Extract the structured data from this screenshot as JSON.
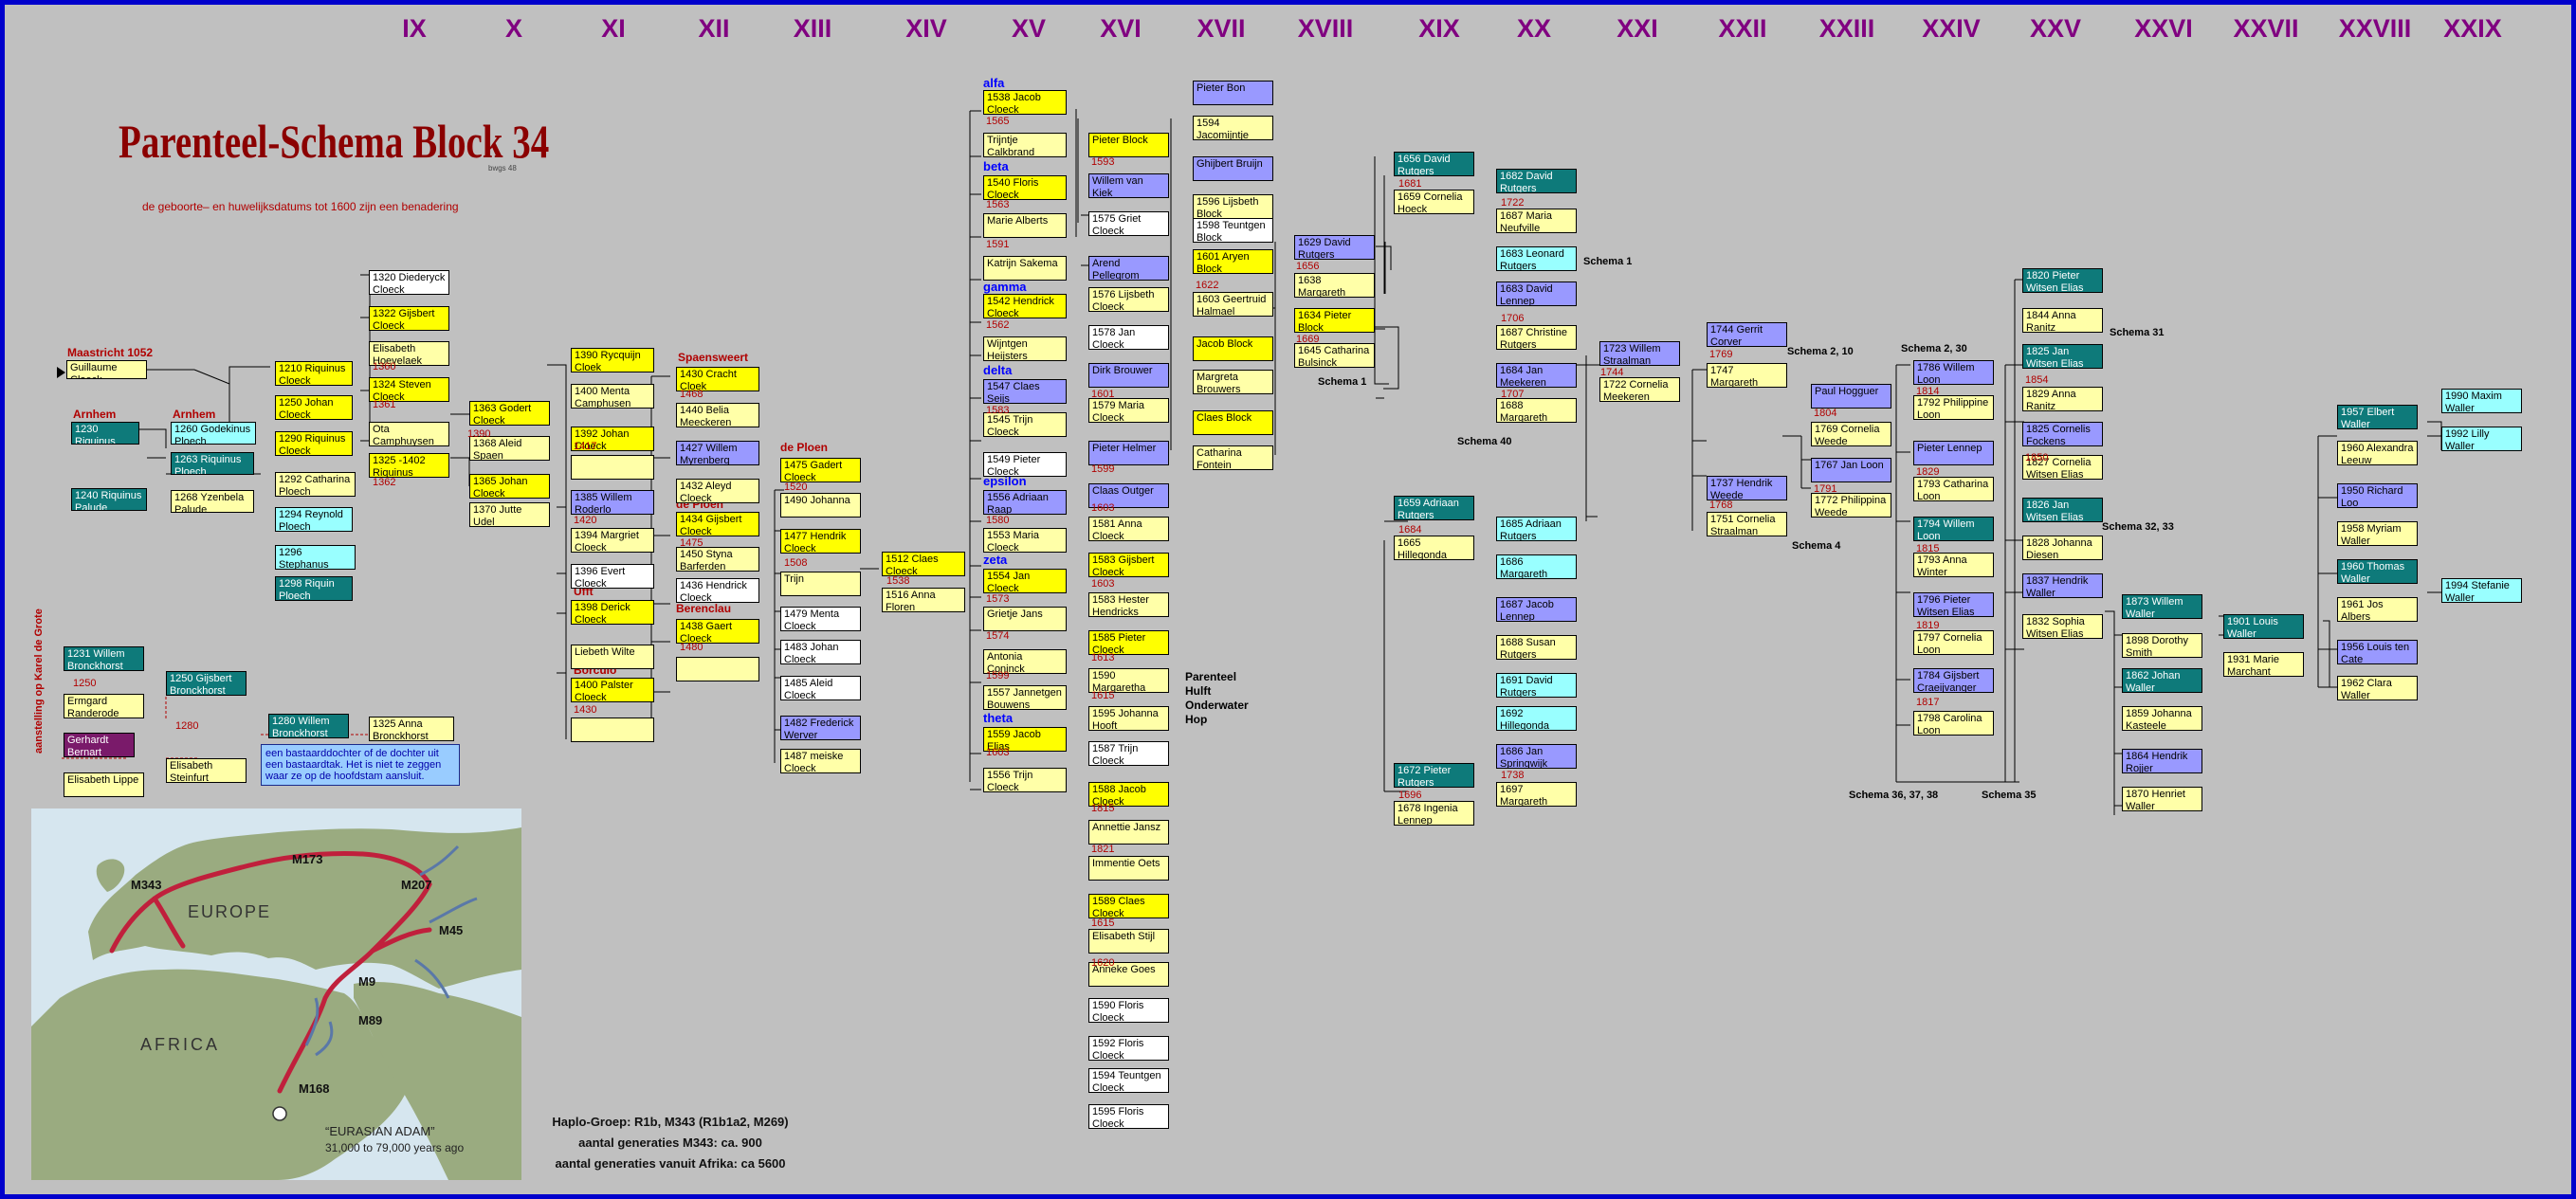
{
  "title": "Parenteel-Schema Block 34",
  "title_small": "bwgs 48",
  "subtitle": "de geboorte– en huwelijksdatums tot 1600 zijn een benadering",
  "centuries": [
    "IX",
    "X",
    "XI",
    "XII",
    "XIII",
    "XIV",
    "XV",
    "XVI",
    "XVII",
    "XVIII",
    "XIX",
    "XX",
    "XXI",
    "XXII",
    "XXIII",
    "XXIV",
    "XXV",
    "XXVI",
    "XXVII",
    "XXVIII",
    "XXIX"
  ],
  "places": {
    "maastricht": "Maastricht 1052",
    "arnhem1": "Arnhem",
    "arnhem2": "Arnhem",
    "spaensweert": "Spaensweert",
    "deploen1": "de Ploen",
    "deploen2": "de Ploen",
    "deploen3": "de Ploen",
    "berenclau": "Berenclau",
    "ufft": "Ufft",
    "borculo": "Borculo"
  },
  "vertical_note": "aanstelling op Karel de Grote",
  "bastard_note": "een bastaarddochter of de dochter uit een bastaardtak. Het is niet te zeggen waar ze op de hoofdstam aansluit.",
  "greek": {
    "alfa": "alfa",
    "beta": "beta",
    "gamma": "gamma",
    "delta": "delta",
    "epsilon": "epsilon",
    "zeta": "zeta",
    "theta": "theta"
  },
  "parent_note": [
    "Parenteel",
    "Hulft",
    "Onderwater",
    "Hop"
  ],
  "schemas": {
    "s1a": "Schema 1",
    "s1b": "Schema 1",
    "s40": "Schema 40",
    "s210": "Schema 2, 10",
    "s230": "Schema 2, 30",
    "s31": "Schema 31",
    "s4": "Schema 4",
    "s3233": "Schema 32, 33",
    "s363738": "Schema 36, 37, 38",
    "s35": "Schema 35"
  },
  "haplo": [
    "Haplo-Groep: R1b, M343 (R1b1a2, M269)",
    "aantal generaties M343: ca. 900",
    "aantal generaties vanuit Afrika: ca 5600"
  ],
  "map": {
    "europe": "EUROPE",
    "africa": "AFRICA",
    "adam": "“EURASIAN ADAM”",
    "adam_years": "31,000 to 79,000 years ago",
    "markers": [
      "M343",
      "M173",
      "M207",
      "M45",
      "M9",
      "M89",
      "M168"
    ]
  },
  "colors": {
    "frame": "#0000cc",
    "background": "#c0c0c0",
    "century": "#800080",
    "marriage": "#b00000",
    "yellow": "#ffff00",
    "light_yellow": "#ffffa8",
    "blue": "#9999ff",
    "teal": "#0e7a7a",
    "cyan": "#99ffff"
  },
  "persons": [
    {
      "t": "Guillaume Cloeck",
      "c": "ly"
    },
    {
      "t": "1230 Riquinus Ploech",
      "c": "t"
    },
    {
      "t": "1240 Riquinus Palude",
      "c": "t"
    },
    {
      "t": "1260 Godekinus Ploech",
      "c": "c"
    },
    {
      "t": "1263 Riquinus Ploech",
      "c": "t"
    },
    {
      "t": "1268 Yzenbela Palude",
      "c": "ly"
    },
    {
      "t": "1210 Riquinus Cloeck",
      "c": "y"
    },
    {
      "t": "1250 Johan Cloeck",
      "c": "y"
    },
    {
      "t": "1290 Riquinus Cloeck",
      "c": "y"
    },
    {
      "t": "1292 Catharina Ploech",
      "c": "ly"
    },
    {
      "t": "1294 Reynold Ploech",
      "c": "c"
    },
    {
      "t": "1296 Stephanus Ploech",
      "c": "c"
    },
    {
      "t": "1298 Riquin Ploech",
      "c": "t"
    },
    {
      "t": "1320 Diederyck Cloeck",
      "c": "w"
    },
    {
      "t": "1322 Gijsbert Cloeck",
      "c": "y"
    },
    {
      "t": "Elisabeth Hoevelaek",
      "c": "ly"
    },
    {
      "t": "1324 Steven Cloeck",
      "c": "y"
    },
    {
      "t": "Ota Camphuysen",
      "c": "ly"
    },
    {
      "t": "1325 -1402 Riquinus Cloeck",
      "c": "y"
    },
    {
      "t": "1363 Godert Cloeck",
      "c": "y"
    },
    {
      "t": "1368 Aleid Spaen",
      "c": "ly"
    },
    {
      "t": "1365 Johan Cloeck",
      "c": "y"
    },
    {
      "t": "1370 Jutte Udel",
      "c": "ly"
    },
    {
      "t": "1231 Willem Bronckhorst",
      "c": "t"
    },
    {
      "t": "Ermgard Randerode",
      "c": "ly"
    },
    {
      "t": "Gerhardt Bernart",
      "c": "pu"
    },
    {
      "t": "Elisabeth Lippe",
      "c": "ly"
    },
    {
      "t": "1250 Gijsbert Bronckhorst",
      "c": "t"
    },
    {
      "t": "Elisabeth Steinfurt",
      "c": "ly"
    },
    {
      "t": "1280 Willem Bronckhorst",
      "c": "t"
    },
    {
      "t": "1325 Anna Bronckhorst",
      "c": "ly"
    },
    {
      "t": "1390 Rycquijn Cloek",
      "c": "y"
    },
    {
      "t": "1400 Menta Camphusen",
      "c": "ly"
    },
    {
      "t": "1392 Johan Cloeck",
      "c": "y"
    },
    {
      "t": "",
      "c": "ly"
    },
    {
      "t": "1385 Willem Roderlo",
      "c": "bl"
    },
    {
      "t": "1394 Margriet Cloeck",
      "c": "ly"
    },
    {
      "t": "1396 Evert Cloeck",
      "c": "w"
    },
    {
      "t": "1398 Derick Cloeck",
      "c": "y"
    },
    {
      "t": "Liebeth Wilte",
      "c": "ly"
    },
    {
      "t": "1400 Palster Cloeck",
      "c": "y"
    },
    {
      "t": "",
      "c": "ly"
    },
    {
      "t": "1430 Cracht Cloek",
      "c": "y"
    },
    {
      "t": "1440 Belia Meeckeren",
      "c": "ly"
    },
    {
      "t": "1427 Willem Myrenberg",
      "c": "bl"
    },
    {
      "t": "1432 Aleyd Cloeck",
      "c": "ly"
    },
    {
      "t": "1434 Gijsbert Cloeck",
      "c": "y"
    },
    {
      "t": "1450 Styna Barferden",
      "c": "ly"
    },
    {
      "t": "1436 Hendrick Cloeck",
      "c": "w"
    },
    {
      "t": "1438 Gaert Cloeck",
      "c": "y"
    },
    {
      "t": "",
      "c": "ly"
    },
    {
      "t": "1475 Gadert Cloeck",
      "c": "y"
    },
    {
      "t": "1490 Johanna",
      "c": "ly"
    },
    {
      "t": "1477 Hendrik Cloeck",
      "c": "y"
    },
    {
      "t": "Trijn",
      "c": "ly"
    },
    {
      "t": "1479 Menta Cloeck",
      "c": "w"
    },
    {
      "t": "1483 Johan Cloeck",
      "c": "w"
    },
    {
      "t": "1485 Aleid Cloeck",
      "c": "w"
    },
    {
      "t": "1482 Frederick Werver",
      "c": "bl"
    },
    {
      "t": "1487 meiske Cloeck",
      "c": "ly"
    },
    {
      "t": "1512 Claes Cloeck",
      "c": "y"
    },
    {
      "t": "1516 Anna Floren",
      "c": "ly"
    },
    {
      "t": "1538 Jacob Cloeck",
      "c": "y"
    },
    {
      "t": "Trijntje Calkbrand",
      "c": "ly"
    },
    {
      "t": "1540 Floris Cloeck",
      "c": "y"
    },
    {
      "t": "Marie Alberts",
      "c": "ly"
    },
    {
      "t": "Katrijn Sakema",
      "c": "ly"
    },
    {
      "t": "1542 Hendrick Cloeck",
      "c": "y"
    },
    {
      "t": "Wijntgen Heijsters",
      "c": "ly"
    },
    {
      "t": "1547 Claes Seijs",
      "c": "bl"
    },
    {
      "t": "1545 Trijn Cloeck",
      "c": "ly"
    },
    {
      "t": "1549 Pieter Cloeck",
      "c": "w"
    },
    {
      "t": "1556 Adriaan Raap",
      "c": "bl"
    },
    {
      "t": "1553 Maria Cloeck",
      "c": "ly"
    },
    {
      "t": "1554 Jan Cloeck",
      "c": "y"
    },
    {
      "t": "Grietje Jans",
      "c": "ly"
    },
    {
      "t": "Antonia Coninck",
      "c": "ly"
    },
    {
      "t": "1557 Jannetgen Bouwens",
      "c": "ly"
    },
    {
      "t": "1559 Jacob Elias",
      "c": "y"
    },
    {
      "t": "1556 Trijn Cloeck",
      "c": "ly"
    },
    {
      "t": "Pieter Block",
      "c": "y"
    },
    {
      "t": "Willem van Kiek",
      "c": "bl"
    },
    {
      "t": "1575 Griet Cloeck",
      "c": "w"
    },
    {
      "t": "Arend Pellegrom",
      "c": "bl"
    },
    {
      "t": "1576 Lijsbeth Cloeck",
      "c": "ly"
    },
    {
      "t": "1578 Jan Cloeck",
      "c": "w"
    },
    {
      "t": "Dirk Brouwer",
      "c": "bl"
    },
    {
      "t": "1579 Maria Cloeck",
      "c": "ly"
    },
    {
      "t": "Pieter Helmer",
      "c": "bl"
    },
    {
      "t": "Claas Outger",
      "c": "bl"
    },
    {
      "t": "1581 Anna Cloeck",
      "c": "ly"
    },
    {
      "t": "1583 Gijsbert Cloeck",
      "c": "y"
    },
    {
      "t": "1583 Hester Hendricks",
      "c": "ly"
    },
    {
      "t": "1585 Pieter Cloeck",
      "c": "y"
    },
    {
      "t": "1590 Margaretha Noyer",
      "c": "ly"
    },
    {
      "t": "1595 Johanna Hooft",
      "c": "ly"
    },
    {
      "t": "1587 Trijn Cloeck",
      "c": "w"
    },
    {
      "t": "1588 Jacob Cloeck",
      "c": "y"
    },
    {
      "t": "Annettie Jansz",
      "c": "ly"
    },
    {
      "t": "Immentie Oets",
      "c": "ly"
    },
    {
      "t": "1589 Claes Cloeck",
      "c": "y"
    },
    {
      "t": "Elisabeth Stijl",
      "c": "ly"
    },
    {
      "t": "Anneke Goes",
      "c": "ly"
    },
    {
      "t": "1590 Floris Cloeck",
      "c": "w"
    },
    {
      "t": "1592 Floris Cloeck",
      "c": "w"
    },
    {
      "t": "1594 Teuntgen Cloeck",
      "c": "w"
    },
    {
      "t": "1595 Floris Cloeck",
      "c": "w"
    },
    {
      "t": "Pieter Bon",
      "c": "bl"
    },
    {
      "t": "1594 Jacomijntje Block",
      "c": "ly"
    },
    {
      "t": "Ghijbert Bruijn",
      "c": "bl"
    },
    {
      "t": "1596 Lijsbeth Block",
      "c": "ly"
    },
    {
      "t": "1598 Teuntgen Block",
      "c": "w"
    },
    {
      "t": "1601 Aryen Block",
      "c": "y"
    },
    {
      "t": "1603 Geertruid Halmael",
      "c": "ly"
    },
    {
      "t": "Jacob Block",
      "c": "y"
    },
    {
      "t": "Margreta Brouwers",
      "c": "ly"
    },
    {
      "t": "Claes Block",
      "c": "y"
    },
    {
      "t": "Catharina Fontein",
      "c": "ly"
    },
    {
      "t": "1629 David Rutgers",
      "c": "bl"
    },
    {
      "t": "1638 Margareth Block",
      "c": "ly"
    },
    {
      "t": "1634 Pieter Block",
      "c": "y"
    },
    {
      "t": "1645 Catharina Bulsinck",
      "c": "ly"
    },
    {
      "t": "1656 David Rutgers",
      "c": "t"
    },
    {
      "t": "1659 Cornelia Hoeck",
      "c": "ly"
    },
    {
      "t": "1659 Adriaan Rutgers",
      "c": "t"
    },
    {
      "t": "1665 Hillegonda Gelder",
      "c": "ly"
    },
    {
      "t": "1672 Pieter Rutgers",
      "c": "t"
    },
    {
      "t": "1678 Ingenia Lennep",
      "c": "ly"
    },
    {
      "t": "1682 David Rutgers",
      "c": "t"
    },
    {
      "t": "1687 Maria Neufville",
      "c": "ly"
    },
    {
      "t": "1683 Leonard Rutgers",
      "c": "c"
    },
    {
      "t": "1683 David Lennep",
      "c": "bl"
    },
    {
      "t": "1687 Christine Rutgers",
      "c": "ly"
    },
    {
      "t": "1684 Jan Meekeren",
      "c": "bl"
    },
    {
      "t": "1688 Margareth Rutgers",
      "c": "ly"
    },
    {
      "t": "1685 Adriaan Rutgers",
      "c": "c"
    },
    {
      "t": "1686 Margareth Rutgers",
      "c": "c"
    },
    {
      "t": "1687 Jacob Lennep",
      "c": "bl"
    },
    {
      "t": "1688 Susan Rutgers",
      "c": "ly"
    },
    {
      "t": "1691 David Rutgers",
      "c": "c"
    },
    {
      "t": "1692 Hillegonda Rutgers",
      "c": "c"
    },
    {
      "t": "1686 Jan Springwijk",
      "c": "bl"
    },
    {
      "t": "1697 Margareth Rutgers",
      "c": "ly"
    },
    {
      "t": "1723 Willem Straalman",
      "c": "bl"
    },
    {
      "t": "1722 Cornelia Meekeren",
      "c": "ly"
    },
    {
      "t": "1744 Gerrit Corver",
      "c": "bl"
    },
    {
      "t": "1747 Margareth Straalman",
      "c": "ly"
    },
    {
      "t": "1737 Hendrik Weede",
      "c": "bl"
    },
    {
      "t": "1751 Cornelia Straalman",
      "c": "ly"
    },
    {
      "t": "Paul Hogguer",
      "c": "bl"
    },
    {
      "t": "1769 Cornelia Weede",
      "c": "ly"
    },
    {
      "t": "1767 Jan Loon",
      "c": "bl"
    },
    {
      "t": "1772 Philippina Weede",
      "c": "ly"
    },
    {
      "t": "1786 Willem Loon",
      "c": "bl"
    },
    {
      "t": "1792 Philippine Loon",
      "c": "ly"
    },
    {
      "t": "Pieter Lennep",
      "c": "bl"
    },
    {
      "t": "1793 Catharina Loon",
      "c": "ly"
    },
    {
      "t": "1794 Willem Loon",
      "c": "t"
    },
    {
      "t": "1793 Anna Winter",
      "c": "ly"
    },
    {
      "t": "1796 Pieter Witsen Elias",
      "c": "bl"
    },
    {
      "t": "1797 Cornelia Loon",
      "c": "ly"
    },
    {
      "t": "1784 Gijsbert Craeijvanger",
      "c": "bl"
    },
    {
      "t": "1798 Carolina Loon",
      "c": "ly"
    },
    {
      "t": "1820 Pieter Witsen Elias",
      "c": "t"
    },
    {
      "t": "1844 Anna Ranitz",
      "c": "ly"
    },
    {
      "t": "1825 Jan Witsen Elias",
      "c": "t"
    },
    {
      "t": "1829 Anna Ranitz",
      "c": "ly"
    },
    {
      "t": "1825 Cornelis Fockens",
      "c": "bl"
    },
    {
      "t": "1827 Cornelia Witsen Elias",
      "c": "ly"
    },
    {
      "t": "1826 Jan Witsen Elias",
      "c": "t"
    },
    {
      "t": "1828 Johanna Diesen",
      "c": "ly"
    },
    {
      "t": "1837 Hendrik Waller",
      "c": "bl"
    },
    {
      "t": "1832 Sophia Witsen Elias",
      "c": "ly"
    },
    {
      "t": "1873 Willem Waller",
      "c": "t"
    },
    {
      "t": "1898 Dorothy Smith",
      "c": "ly"
    },
    {
      "t": "1862 Johan Waller",
      "c": "t"
    },
    {
      "t": "1859 Johanna Kasteele",
      "c": "ly"
    },
    {
      "t": "1864 Hendrik Rojjer",
      "c": "bl"
    },
    {
      "t": "1870 Henriet Waller",
      "c": "ly"
    },
    {
      "t": "1901 Louis Waller",
      "c": "t"
    },
    {
      "t": "1931 Marie Marchant",
      "c": "ly"
    },
    {
      "t": "1957 Elbert Waller",
      "c": "t"
    },
    {
      "t": "1960 Alexandra Leeuw",
      "c": "ly"
    },
    {
      "t": "1950 Richard Loo",
      "c": "bl"
    },
    {
      "t": "1958 Myriam Waller",
      "c": "ly"
    },
    {
      "t": "1960 Thomas Waller",
      "c": "t"
    },
    {
      "t": "1961 Jos Albers",
      "c": "ly"
    },
    {
      "t": "1956 Louis ten Cate",
      "c": "bl"
    },
    {
      "t": "1962 Clara Waller",
      "c": "ly"
    },
    {
      "t": "1990 Maxim Waller",
      "c": "c"
    },
    {
      "t": "1992 Lilly Waller",
      "c": "c"
    },
    {
      "t": "1994 Stefanie Waller",
      "c": "c"
    }
  ],
  "marriages": [
    "1250",
    "1280",
    "1360",
    "1361",
    "1390",
    "1417",
    "1420",
    "1362",
    "1468",
    "1475",
    "1480",
    "1430",
    "1520",
    "1508",
    "1538",
    "1565",
    "1563",
    "1591",
    "1562",
    "1583",
    "1580",
    "1573",
    "1574",
    "1599",
    "1603",
    "1593",
    "1601",
    "1599",
    "1603",
    "1603",
    "1613",
    "1615",
    "1815",
    "1821",
    "1615",
    "1620",
    "1622",
    "1656",
    "1669",
    "1681",
    "1684",
    "1696",
    "1722",
    "1706",
    "1707",
    "1738",
    "1744",
    "1769",
    "1768",
    "1804",
    "1791",
    "1814",
    "1829",
    "1815",
    "1819",
    "1817",
    "1854",
    "1850"
  ]
}
